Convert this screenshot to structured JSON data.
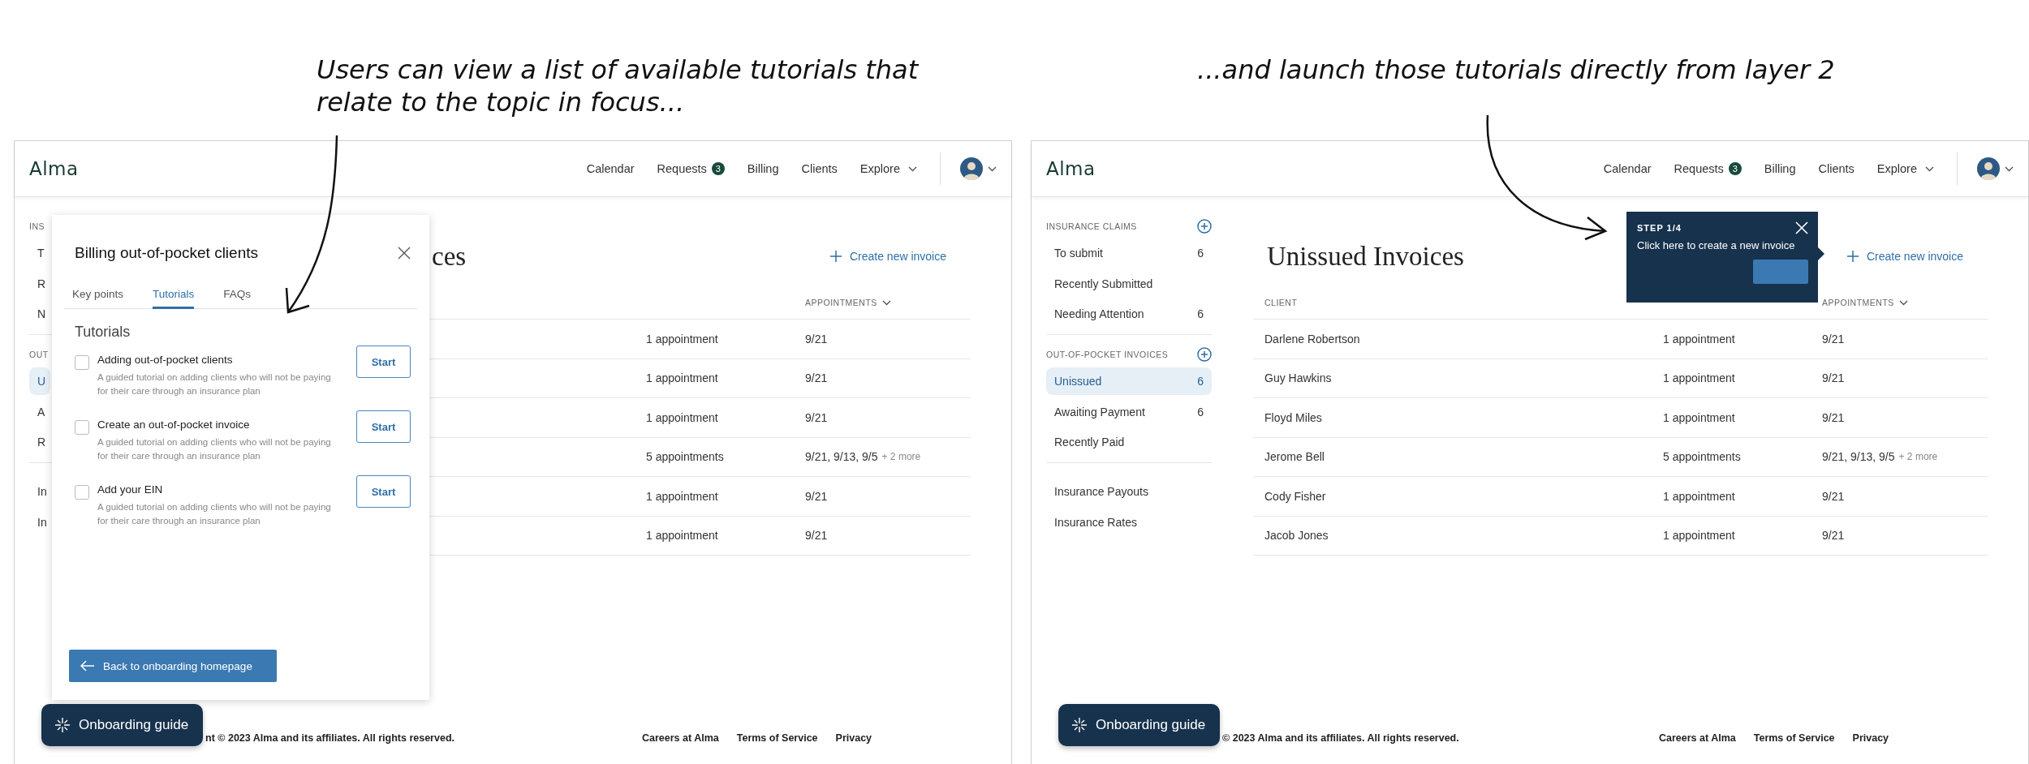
{
  "annotations": [
    {
      "text": "Users can view a list of available tutorials that relate to the topic in focus..."
    },
    {
      "text": "...and launch those tutorials directly from layer 2"
    }
  ],
  "screens": [
    {
      "kind": "tutorials",
      "logo": "Alma",
      "nav": [
        {
          "label": "Calendar"
        },
        {
          "label": "Requests",
          "badge": "3"
        },
        {
          "label": "Billing"
        },
        {
          "label": "Clients"
        },
        {
          "label": "Explore",
          "menu": true
        }
      ],
      "sidebar": {
        "sections": [
          {
            "heading": "INS",
            "items": [
              {
                "label": "T",
                "selected": false
              },
              {
                "label": "R",
                "selected": false
              },
              {
                "label": "N",
                "selected": false
              }
            ]
          },
          {
            "heading": "OUT",
            "items": [
              {
                "label": "U",
                "selected": true
              },
              {
                "label": "A",
                "selected": false
              },
              {
                "label": "R",
                "selected": false
              }
            ]
          },
          {
            "items": [
              {
                "label": "In",
                "selected": false
              },
              {
                "label": "In",
                "selected": false
              }
            ]
          }
        ]
      },
      "title": "ces",
      "create_button": "Create new invoice",
      "table": {
        "headers": {
          "appointments": "APPOINTMENTS"
        },
        "rows": [
          {
            "count": "1 appointment",
            "dates": "9/21"
          },
          {
            "count": "1 appointment",
            "dates": "9/21"
          },
          {
            "count": "1 appointment",
            "dates": "9/21"
          },
          {
            "count": "5 appointments",
            "dates": "9/21, 9/13, 9/5",
            "more": "+ 2 more"
          },
          {
            "count": "1 appointment",
            "dates": "9/21"
          },
          {
            "count": "1 appointment",
            "dates": "9/21"
          }
        ]
      },
      "footer": {
        "copyright": "nt © 2023 Alma and its affiliates. All rights reserved.",
        "links": [
          "Careers at Alma",
          "Terms of Service",
          "Privacy"
        ]
      },
      "guide_button": "Onboarding guide",
      "overlay": {
        "kind": "panel",
        "title": "Billing out-of-pocket clients",
        "tabs": [
          {
            "label": "Key points",
            "selected": false
          },
          {
            "label": "Tutorials",
            "selected": true
          },
          {
            "label": "FAQs",
            "selected": false
          }
        ],
        "heading": "Tutorials",
        "tutorials": [
          {
            "title": "Adding out-of-pocket clients",
            "description": "A guided tutorial on adding clients who will not be paying for their care through an insurance plan",
            "checked": false,
            "button": "Start"
          },
          {
            "title": "Create an out-of-pocket invoice",
            "description": "A guided tutorial on adding clients who will not be paying for their care through an insurance plan",
            "checked": false,
            "button": "Start"
          },
          {
            "title": "Add your EIN",
            "description": "A guided tutorial on adding clients who will not be paying for their care through an insurance plan",
            "checked": false,
            "button": "Start"
          }
        ],
        "back_button": "Back to onboarding homepage"
      }
    },
    {
      "kind": "tour",
      "logo": "Alma",
      "nav": [
        {
          "label": "Calendar"
        },
        {
          "label": "Requests",
          "badge": "3"
        },
        {
          "label": "Billing"
        },
        {
          "label": "Clients"
        },
        {
          "label": "Explore",
          "menu": true
        }
      ],
      "sidebar": {
        "sections": [
          {
            "heading": "INSURANCE CLAIMS",
            "add_icon": true,
            "items": [
              {
                "label": "To submit",
                "count": "6",
                "selected": false
              },
              {
                "label": "Recently Submitted",
                "selected": false
              },
              {
                "label": "Needing Attention",
                "count": "6",
                "selected": false
              }
            ]
          },
          {
            "heading": "OUT-OF-POCKET INVOICES",
            "add_icon": true,
            "items": [
              {
                "label": "Unissued",
                "count": "6",
                "selected": true
              },
              {
                "label": "Awaiting Payment",
                "count": "6",
                "selected": false
              },
              {
                "label": "Recently Paid",
                "selected": false
              }
            ]
          },
          {
            "items": [
              {
                "label": "Insurance Payouts",
                "selected": false
              },
              {
                "label": "Insurance Rates",
                "selected": false
              }
            ]
          }
        ]
      },
      "title": "Unissued Invoices",
      "create_button": "Create new invoice",
      "table": {
        "headers": {
          "client": "CLIENT",
          "appointments": "APPOINTMENTS"
        },
        "rows": [
          {
            "client": "Darlene Robertson",
            "count": "1 appointment",
            "dates": "9/21"
          },
          {
            "client": "Guy Hawkins",
            "count": "1 appointment",
            "dates": "9/21"
          },
          {
            "client": "Floyd Miles",
            "count": "1 appointment",
            "dates": "9/21"
          },
          {
            "client": "Jerome Bell",
            "count": "5 appointments",
            "dates": "9/21, 9/13, 9/5",
            "more": "+ 2 more"
          },
          {
            "client": "Cody Fisher",
            "count": "1 appointment",
            "dates": "9/21"
          },
          {
            "client": "Jacob Jones",
            "count": "1 appointment",
            "dates": "9/21"
          }
        ]
      },
      "footer": {
        "copyright": "© 2023 Alma and its affiliates. All rights reserved.",
        "links": [
          "Careers at Alma",
          "Terms of Service",
          "Privacy"
        ]
      },
      "guide_button": "Onboarding guide",
      "overlay": {
        "kind": "tour",
        "step": "STEP 1/4",
        "text": "Click here to create a new invoice"
      }
    }
  ]
}
